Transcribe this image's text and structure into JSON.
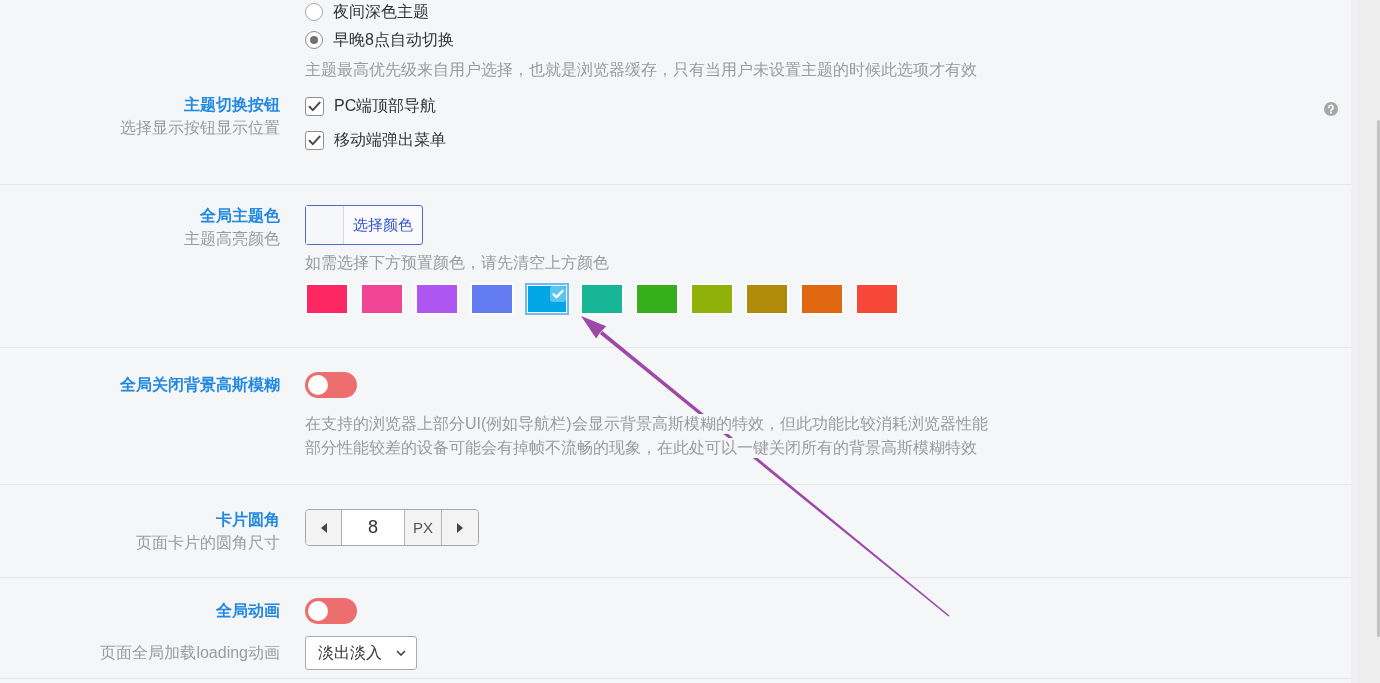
{
  "radio_group": {
    "options": [
      {
        "label": "夜间深色主题",
        "selected": false
      },
      {
        "label": "早晚8点自动切换",
        "selected": true
      }
    ],
    "hint": "主题最高优先级来自用户选择，也就是浏览器缓存，只有当用户未设置主题的时候此选项才有效"
  },
  "fields": [
    {
      "kind": "checkboxes",
      "title": "主题切换按钮",
      "subtitle": "选择显示按钮显示位置",
      "help": true,
      "options": [
        {
          "label": "PC端顶部导航",
          "checked": true
        },
        {
          "label": "移动端弹出菜单",
          "checked": true
        }
      ]
    },
    {
      "kind": "color",
      "title": "全局主题色",
      "subtitle": "主题高亮颜色",
      "picker_label": "选择颜色",
      "hint": "如需选择下方预置颜色，请先清空上方颜色",
      "swatches": [
        {
          "color": "#fd2761",
          "selected": false
        },
        {
          "color": "#f04494",
          "selected": false
        },
        {
          "color": "#ae56f1",
          "selected": false
        },
        {
          "color": "#627bf0",
          "selected": false
        },
        {
          "color": "#02a6e5",
          "selected": true
        },
        {
          "color": "#16b697",
          "selected": false
        },
        {
          "color": "#37ae1c",
          "selected": false
        },
        {
          "color": "#8fb10a",
          "selected": false
        },
        {
          "color": "#b08b09",
          "selected": false
        },
        {
          "color": "#e06612",
          "selected": false
        },
        {
          "color": "#f74837",
          "selected": false
        }
      ]
    },
    {
      "kind": "switch",
      "title": "全局关闭背景高斯模糊",
      "on": false,
      "description": [
        "在支持的浏览器上部分UI(例如导航栏)会显示背景高斯模糊的特效，但此功能比较消耗浏览器性能",
        "部分性能较差的设备可能会有掉帧不流畅的现象，在此处可以一键关闭所有的背景高斯模糊特效"
      ]
    },
    {
      "kind": "stepper",
      "title": "卡片圆角",
      "subtitle": "页面卡片的圆角尺寸",
      "value": "8",
      "unit": "PX"
    },
    {
      "kind": "switch",
      "title": "全局动画",
      "on": false,
      "sub_field": {
        "label": "页面全局加载loading动画",
        "select": "淡出淡入"
      }
    }
  ],
  "annotation": {
    "kind": "arrow"
  }
}
